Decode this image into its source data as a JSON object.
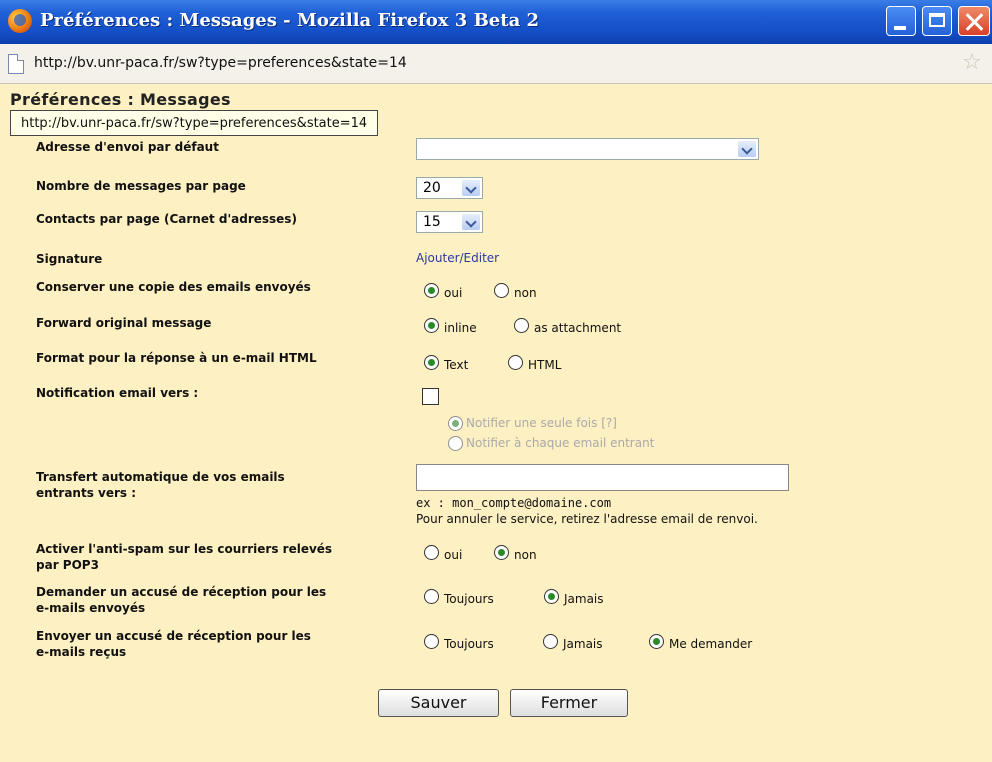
{
  "window": {
    "title": "Préférences : Messages - Mozilla Firefox 3 Beta 2",
    "url": "http://bv.unr-paca.fr/sw?type=preferences&state=14"
  },
  "page": {
    "heading": "Préférences : Messages",
    "tooltip": "http://bv.unr-paca.fr/sw?type=preferences&state=14"
  },
  "form": {
    "default_address": {
      "label": "Adresse d'envoi par défaut",
      "value": ""
    },
    "messages_per_page": {
      "label": "Nombre de messages par page",
      "value": "20"
    },
    "contacts_per_page": {
      "label": "Contacts par page (Carnet d'adresses)",
      "value": "15"
    },
    "signature": {
      "label": "Signature",
      "link": "Ajouter/Editer"
    },
    "keep_copy": {
      "label": "Conserver une copie des emails envoyés",
      "options": [
        "oui",
        "non"
      ],
      "selected": "oui"
    },
    "forward_original": {
      "label": "Forward original message",
      "options": [
        "inline",
        "as attachment"
      ],
      "selected": "inline"
    },
    "reply_format": {
      "label": "Format pour la réponse à un e-mail HTML",
      "options": [
        "Text",
        "HTML"
      ],
      "selected": "Text"
    },
    "notification": {
      "label": "Notification email vers :",
      "checked": false,
      "options": [
        "Notifier une seule fois [?]",
        "Notifier à chaque email entrant"
      ],
      "selected": "Notifier une seule fois [?]"
    },
    "transfer": {
      "label_line1": "Transfert automatique de vos emails",
      "label_line2": "entrants vers :",
      "value": "",
      "hint1": "ex : mon_compte@domaine.com",
      "hint2": "Pour annuler le service, retirez l'adresse email de renvoi."
    },
    "antispam": {
      "label_line1": "Activer l'anti-spam sur les courriers relevés",
      "label_line2": "par POP3",
      "options": [
        "oui",
        "non"
      ],
      "selected": "non"
    },
    "request_receipt": {
      "label_line1": "Demander un accusé de réception pour les",
      "label_line2": "e-mails envoyés",
      "options": [
        "Toujours",
        "Jamais"
      ],
      "selected": "Jamais"
    },
    "send_receipt": {
      "label_line1": "Envoyer un accusé de réception pour les",
      "label_line2": "e-mails reçus",
      "options": [
        "Toujours",
        "Jamais",
        "Me demander"
      ],
      "selected": "Me demander"
    }
  },
  "buttons": {
    "save": "Sauver",
    "close": "Fermer"
  },
  "colors": {
    "page_bg": "#fdf0c2",
    "titlebar": "#1f5fd6",
    "link": "#2a3aa0",
    "radio_selected": "#2a8a2a"
  }
}
